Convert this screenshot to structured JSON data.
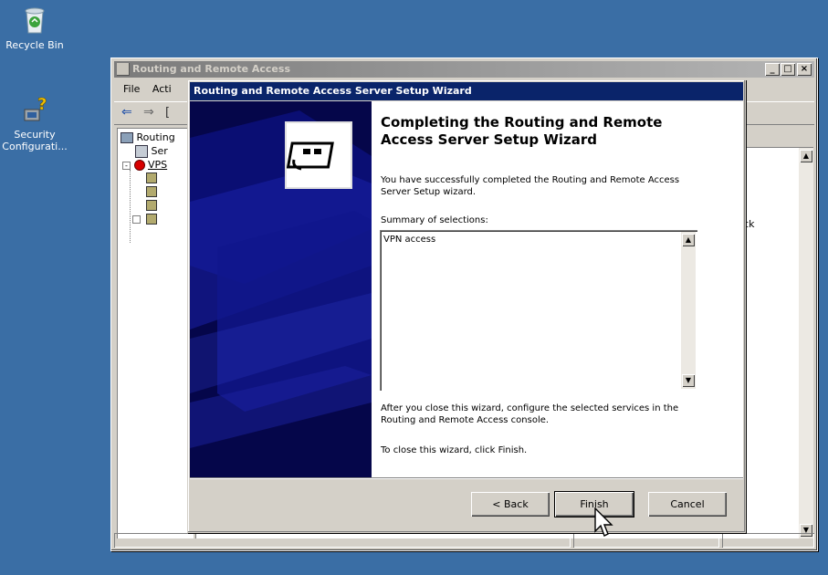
{
  "desktop": {
    "icons": [
      {
        "label": "Recycle Bin",
        "icon": "recycle-bin-icon"
      },
      {
        "label": "Security Configurati...",
        "icon": "security-config-icon"
      }
    ]
  },
  "mmc": {
    "title": "Routing and Remote Access",
    "menu": [
      "File",
      "Acti"
    ],
    "tree": [
      "Routing",
      "Ser",
      "VPS"
    ],
    "right_text": "lick"
  },
  "wizard": {
    "title": "Routing and Remote Access Server Setup Wizard",
    "heading": "Completing the Routing and Remote Access Server Setup Wizard",
    "intro": "You have successfully completed the Routing and Remote Access Server Setup wizard.",
    "summary_label": "Summary of selections:",
    "summary_value": "VPN access",
    "after_text": "After you close this wizard, configure the selected services in the Routing and  Remote Access console.",
    "close_text": "To close this wizard, click Finish.",
    "buttons": {
      "back": "< Back",
      "finish": "Finish",
      "cancel": "Cancel"
    }
  },
  "colors": {
    "desktop": "#3a6ea5",
    "titlebar_active": "#0a246a",
    "banner": "#05064a"
  }
}
